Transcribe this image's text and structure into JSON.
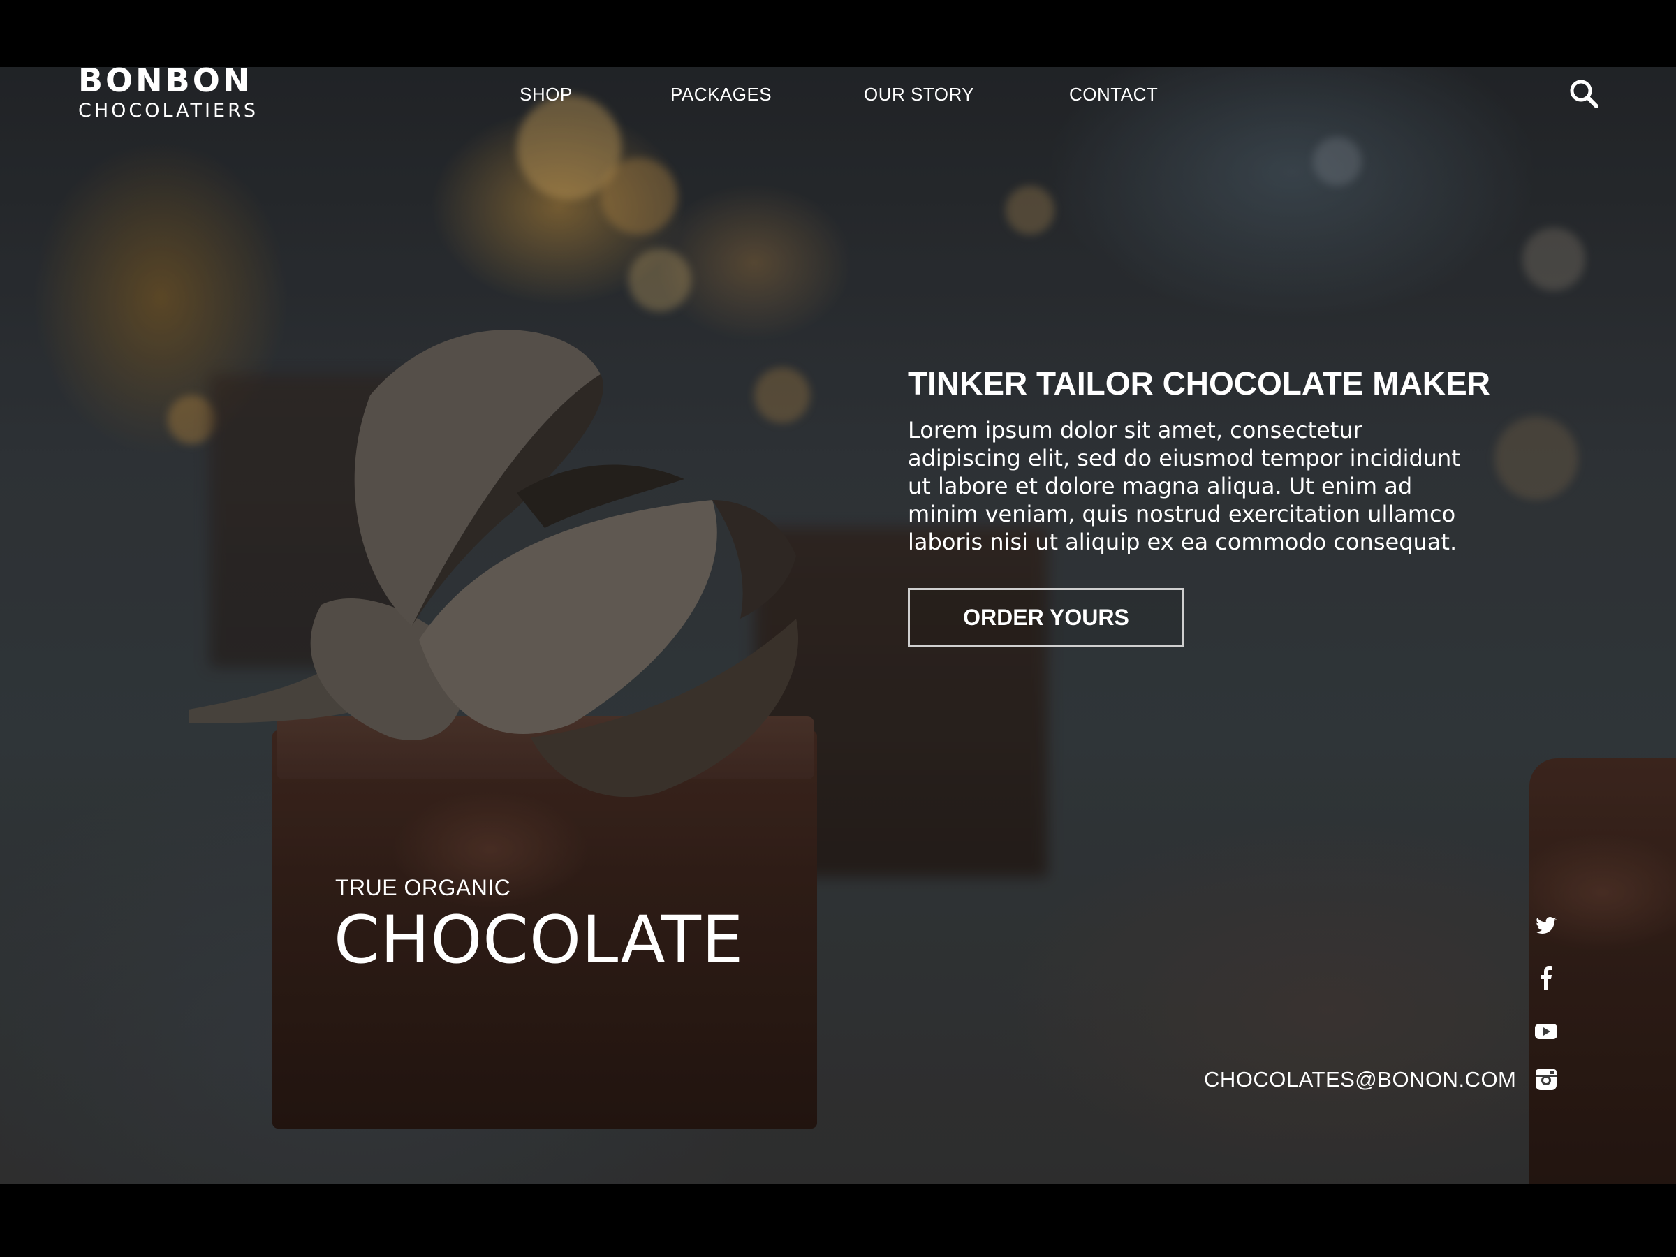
{
  "brand": {
    "name": "BONBON",
    "tagline": "CHOCOLATIERS"
  },
  "nav": {
    "items": [
      {
        "label": "SHOP"
      },
      {
        "label": "PACKAGES"
      },
      {
        "label": "OUR STORY"
      },
      {
        "label": "CONTACT"
      }
    ],
    "search_icon": "search-icon"
  },
  "hero": {
    "headline": "TINKER TAILOR CHOCOLATE MAKER",
    "body": "Lorem ipsum dolor sit amet, consectetur adipiscing elit, sed do eiusmod tempor incididunt ut labore et dolore magna aliqua. Ut enim ad minim veniam, quis nostrud exercitation ullamco laboris nisi ut aliquip ex ea commodo consequat.",
    "cta_label": "ORDER YOURS",
    "kicker": "TRUE ORGANIC",
    "title": "CHOCOLATE"
  },
  "footer": {
    "email": "CHOCOLATES@BONON.COM",
    "socials": [
      {
        "icon": "twitter-icon"
      },
      {
        "icon": "facebook-icon"
      },
      {
        "icon": "youtube-icon"
      },
      {
        "icon": "instagram-icon"
      }
    ]
  },
  "colors": {
    "text": "#ffffff",
    "button_border": "#cfcfcf",
    "letterbox": "#000000"
  }
}
